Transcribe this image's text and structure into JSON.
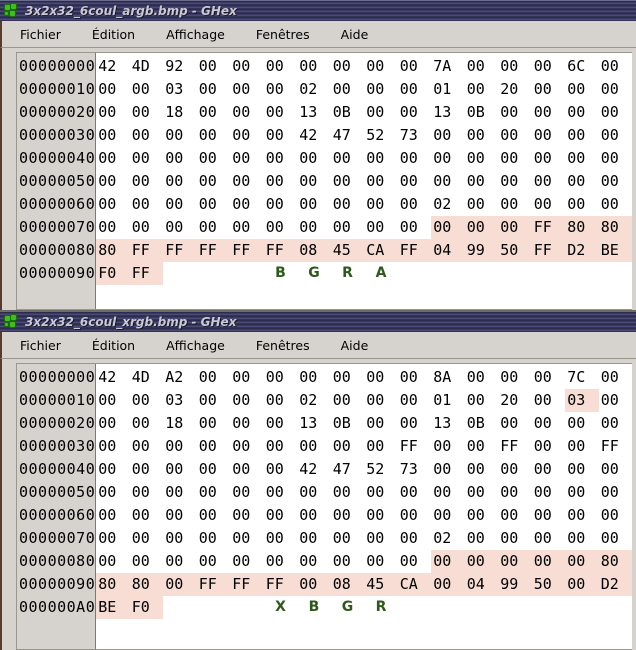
{
  "windows": [
    {
      "title": "3x2x32_6coul_argb.bmp - GHex",
      "icon": "ghex-molecule-icon",
      "menu": [
        {
          "pre": "F",
          "mid": "ichier",
          "post": "",
          "label": "Fichier"
        },
        {
          "label": "Édition"
        },
        {
          "label": "Affichage"
        },
        {
          "label": "Fenêtres"
        },
        {
          "label": "Aide"
        }
      ],
      "rows": [
        {
          "offset": "00000000",
          "bytes": [
            "42",
            "4D",
            "92",
            "00",
            "00",
            "00",
            "00",
            "00",
            "00",
            "00",
            "7A",
            "00",
            "00",
            "00",
            "6C",
            "00"
          ],
          "hl": []
        },
        {
          "offset": "00000010",
          "bytes": [
            "00",
            "00",
            "03",
            "00",
            "00",
            "00",
            "02",
            "00",
            "00",
            "00",
            "01",
            "00",
            "20",
            "00",
            "00",
            "00"
          ],
          "hl": []
        },
        {
          "offset": "00000020",
          "bytes": [
            "00",
            "00",
            "18",
            "00",
            "00",
            "00",
            "13",
            "0B",
            "00",
            "00",
            "13",
            "0B",
            "00",
            "00",
            "00",
            "00"
          ],
          "hl": []
        },
        {
          "offset": "00000030",
          "bytes": [
            "00",
            "00",
            "00",
            "00",
            "00",
            "00",
            "42",
            "47",
            "52",
            "73",
            "00",
            "00",
            "00",
            "00",
            "00",
            "00"
          ],
          "hl": []
        },
        {
          "offset": "00000040",
          "bytes": [
            "00",
            "00",
            "00",
            "00",
            "00",
            "00",
            "00",
            "00",
            "00",
            "00",
            "00",
            "00",
            "00",
            "00",
            "00",
            "00"
          ],
          "hl": []
        },
        {
          "offset": "00000050",
          "bytes": [
            "00",
            "00",
            "00",
            "00",
            "00",
            "00",
            "00",
            "00",
            "00",
            "00",
            "00",
            "00",
            "00",
            "00",
            "00",
            "00"
          ],
          "hl": []
        },
        {
          "offset": "00000060",
          "bytes": [
            "00",
            "00",
            "00",
            "00",
            "00",
            "00",
            "00",
            "00",
            "00",
            "00",
            "02",
            "00",
            "00",
            "00",
            "00",
            "00"
          ],
          "hl": []
        },
        {
          "offset": "00000070",
          "bytes": [
            "00",
            "00",
            "00",
            "00",
            "00",
            "00",
            "00",
            "00",
            "00",
            "00",
            "00",
            "00",
            "00",
            "FF",
            "80",
            "80"
          ],
          "hl": [
            10,
            11,
            12,
            13,
            14,
            15
          ]
        },
        {
          "offset": "00000080",
          "bytes": [
            "80",
            "FF",
            "FF",
            "FF",
            "FF",
            "FF",
            "08",
            "45",
            "CA",
            "FF",
            "04",
            "99",
            "50",
            "FF",
            "D2",
            "BE"
          ],
          "hl": [
            0,
            1,
            2,
            3,
            4,
            5,
            6,
            7,
            8,
            9,
            10,
            11,
            12,
            13,
            14,
            15
          ]
        },
        {
          "offset": "00000090",
          "bytes": [
            "F0",
            "FF",
            "",
            "",
            "",
            "B",
            "G",
            "R",
            "A",
            "",
            "",
            "",
            "",
            "",
            "",
            ""
          ],
          "hl": [
            0,
            1
          ],
          "labels": [
            5,
            6,
            7,
            8
          ]
        }
      ]
    },
    {
      "title": "3x2x32_6coul_xrgb.bmp - GHex",
      "icon": "ghex-molecule-icon",
      "menu": [
        {
          "label": "Fichier"
        },
        {
          "label": "Édition"
        },
        {
          "label": "Affichage"
        },
        {
          "label": "Fenêtres"
        },
        {
          "label": "Aide"
        }
      ],
      "rows": [
        {
          "offset": "00000000",
          "bytes": [
            "42",
            "4D",
            "A2",
            "00",
            "00",
            "00",
            "00",
            "00",
            "00",
            "00",
            "8A",
            "00",
            "00",
            "00",
            "7C",
            "00"
          ],
          "hl": []
        },
        {
          "offset": "00000010",
          "bytes": [
            "00",
            "00",
            "03",
            "00",
            "00",
            "00",
            "02",
            "00",
            "00",
            "00",
            "01",
            "00",
            "20",
            "00",
            "03",
            "00"
          ],
          "hl": [
            14
          ]
        },
        {
          "offset": "00000020",
          "bytes": [
            "00",
            "00",
            "18",
            "00",
            "00",
            "00",
            "13",
            "0B",
            "00",
            "00",
            "13",
            "0B",
            "00",
            "00",
            "00",
            "00"
          ],
          "hl": []
        },
        {
          "offset": "00000030",
          "bytes": [
            "00",
            "00",
            "00",
            "00",
            "00",
            "00",
            "00",
            "00",
            "00",
            "FF",
            "00",
            "00",
            "FF",
            "00",
            "00",
            "FF"
          ],
          "hl": []
        },
        {
          "offset": "00000040",
          "bytes": [
            "00",
            "00",
            "00",
            "00",
            "00",
            "00",
            "42",
            "47",
            "52",
            "73",
            "00",
            "00",
            "00",
            "00",
            "00",
            "00"
          ],
          "hl": []
        },
        {
          "offset": "00000050",
          "bytes": [
            "00",
            "00",
            "00",
            "00",
            "00",
            "00",
            "00",
            "00",
            "00",
            "00",
            "00",
            "00",
            "00",
            "00",
            "00",
            "00"
          ],
          "hl": []
        },
        {
          "offset": "00000060",
          "bytes": [
            "00",
            "00",
            "00",
            "00",
            "00",
            "00",
            "00",
            "00",
            "00",
            "00",
            "00",
            "00",
            "00",
            "00",
            "00",
            "00"
          ],
          "hl": []
        },
        {
          "offset": "00000070",
          "bytes": [
            "00",
            "00",
            "00",
            "00",
            "00",
            "00",
            "00",
            "00",
            "00",
            "00",
            "02",
            "00",
            "00",
            "00",
            "00",
            "00"
          ],
          "hl": []
        },
        {
          "offset": "00000080",
          "bytes": [
            "00",
            "00",
            "00",
            "00",
            "00",
            "00",
            "00",
            "00",
            "00",
            "00",
            "00",
            "00",
            "00",
            "00",
            "00",
            "80"
          ],
          "hl": [
            10,
            11,
            12,
            13,
            14,
            15
          ]
        },
        {
          "offset": "00000090",
          "bytes": [
            "80",
            "80",
            "00",
            "FF",
            "FF",
            "FF",
            "00",
            "08",
            "45",
            "CA",
            "00",
            "04",
            "99",
            "50",
            "00",
            "D2"
          ],
          "hl": [
            0,
            1,
            2,
            3,
            4,
            5,
            6,
            7,
            8,
            9,
            10,
            11,
            12,
            13,
            14,
            15
          ]
        },
        {
          "offset": "000000A0",
          "bytes": [
            "BE",
            "F0",
            "",
            "",
            "",
            "X",
            "B",
            "G",
            "R",
            "",
            "",
            "",
            "",
            "",
            "",
            ""
          ],
          "hl": [
            0,
            1
          ],
          "labels": [
            5,
            6,
            7,
            8
          ]
        }
      ]
    }
  ],
  "colors": {
    "highlight": "#f7ddd3",
    "label_green": "#2d5a1b",
    "chrome": "#d6d3ce",
    "title_text": "#c9c9d6",
    "hex_bg": "#ffffff"
  }
}
